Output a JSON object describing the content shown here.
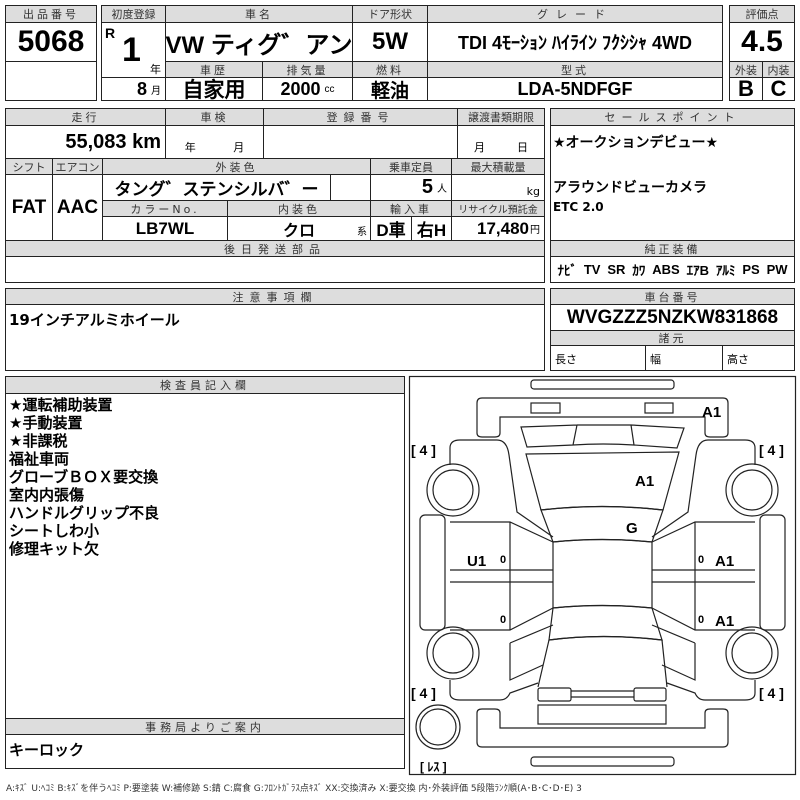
{
  "lot": {
    "label": "出品番号",
    "value": "5068"
  },
  "first_reg": {
    "label": "初度登録",
    "era": "R",
    "year": "1",
    "year_unit": "年",
    "month": "8",
    "month_unit": "月"
  },
  "car_name": {
    "label": "車名",
    "value": "VW ティグ゛アン"
  },
  "door": {
    "label": "ドア形状",
    "value": "5W"
  },
  "grade": {
    "label": "グレード",
    "value": "TDI 4ﾓｰｼｮﾝ ﾊｲﾗｲﾝ ﾌｸｼｼｬ 4WD"
  },
  "history": {
    "label": "車歴",
    "value": "自家用"
  },
  "displacement": {
    "label": "排気量",
    "value": "2000",
    "unit": "cc"
  },
  "fuel": {
    "label": "燃料",
    "value": "軽油"
  },
  "model": {
    "label": "型式",
    "value": "LDA-5NDFGF"
  },
  "score": {
    "label": "評価点",
    "value": "4.5",
    "ext_label": "外装",
    "int_label": "内装",
    "ext": "B",
    "int": "C"
  },
  "mileage": {
    "label": "走行",
    "value": "55,083 km"
  },
  "inspection": {
    "label": "車検",
    "year_unit": "年",
    "month_unit": "月"
  },
  "reg_no": {
    "label": "登録番号"
  },
  "transfer": {
    "label": "譲渡書類期限",
    "month_unit": "月",
    "day_unit": "日"
  },
  "shift": {
    "label": "シフト",
    "value": "FAT"
  },
  "aircon": {
    "label": "エアコン",
    "value": "AAC"
  },
  "ext_color": {
    "label": "外装色",
    "value": "タング゛ステンシルバ゛ー"
  },
  "capacity": {
    "label": "乗車定員",
    "value": "5",
    "unit": "人"
  },
  "max_load": {
    "label": "最大積載量",
    "unit": "kg"
  },
  "color_no": {
    "label": "カラーNo.",
    "value": "LB7WL"
  },
  "int_color": {
    "label": "内装色",
    "value": "クロ",
    "unit": "系"
  },
  "import": {
    "label": "輸入車",
    "type": "D車",
    "handle": "右H"
  },
  "recycle": {
    "label": "リサイクル預託金",
    "value": "17,480",
    "unit": "円"
  },
  "later_parts": {
    "label": "後日発送部品"
  },
  "sales_points": {
    "label": "セールスポイント",
    "items": [
      "★オークションデビュー★",
      "アラウンドビューカメラ",
      "ETC 2.0"
    ]
  },
  "equipment": {
    "label": "純正装備",
    "items": [
      "ﾅﾋﾞ",
      "TV",
      "SR",
      "ｶﾜ",
      "ABS",
      "ｴｱB",
      "ｱﾙﾐ",
      "PS",
      "PW"
    ]
  },
  "notes": {
    "label": "注意事項欄",
    "value": "19インチアルミホイール"
  },
  "chassis": {
    "label": "車台番号",
    "value": "WVGZZZ5NZKW831868"
  },
  "specs": {
    "label": "諸元",
    "length": "長さ",
    "width": "幅",
    "height": "高さ"
  },
  "inspector": {
    "label": "検査員記入欄",
    "items": [
      "★運転補助装置",
      "★手動装置",
      "★非課税",
      "福祉車両",
      "グローブＢＯＸ要交換",
      "室内内張傷",
      "ハンドルグリップ不良",
      "シートしわ小",
      "修理キット欠"
    ]
  },
  "office": {
    "label": "事務局よりご案内",
    "value": "キーロック"
  },
  "diagram": {
    "marks": {
      "front_bumper": "A1",
      "hood": "A1",
      "windshield": "G",
      "left_front_door": "U1",
      "right_front_door": "A1",
      "right_rear_door": "A1"
    },
    "tread": [
      "[ 4 ]",
      "[ 4 ]",
      "[ 4 ]",
      "[ 4 ]"
    ],
    "spare": "[ ﾚｽ ]",
    "zero": "0"
  },
  "legend": "A:ｷｽﾞ U:ﾍｺﾐ B:ｷｽﾞを伴うﾍｺﾐ P:要塗装 W:補修跡 S:錆 C:腐食 G:ﾌﾛﾝﾄｶﾞﾗｽ点ｷｽﾞ XX:交換済み X:要交換 内･外装評価 5段階ﾗﾝｸ順(A･B･C･D･E) 3"
}
